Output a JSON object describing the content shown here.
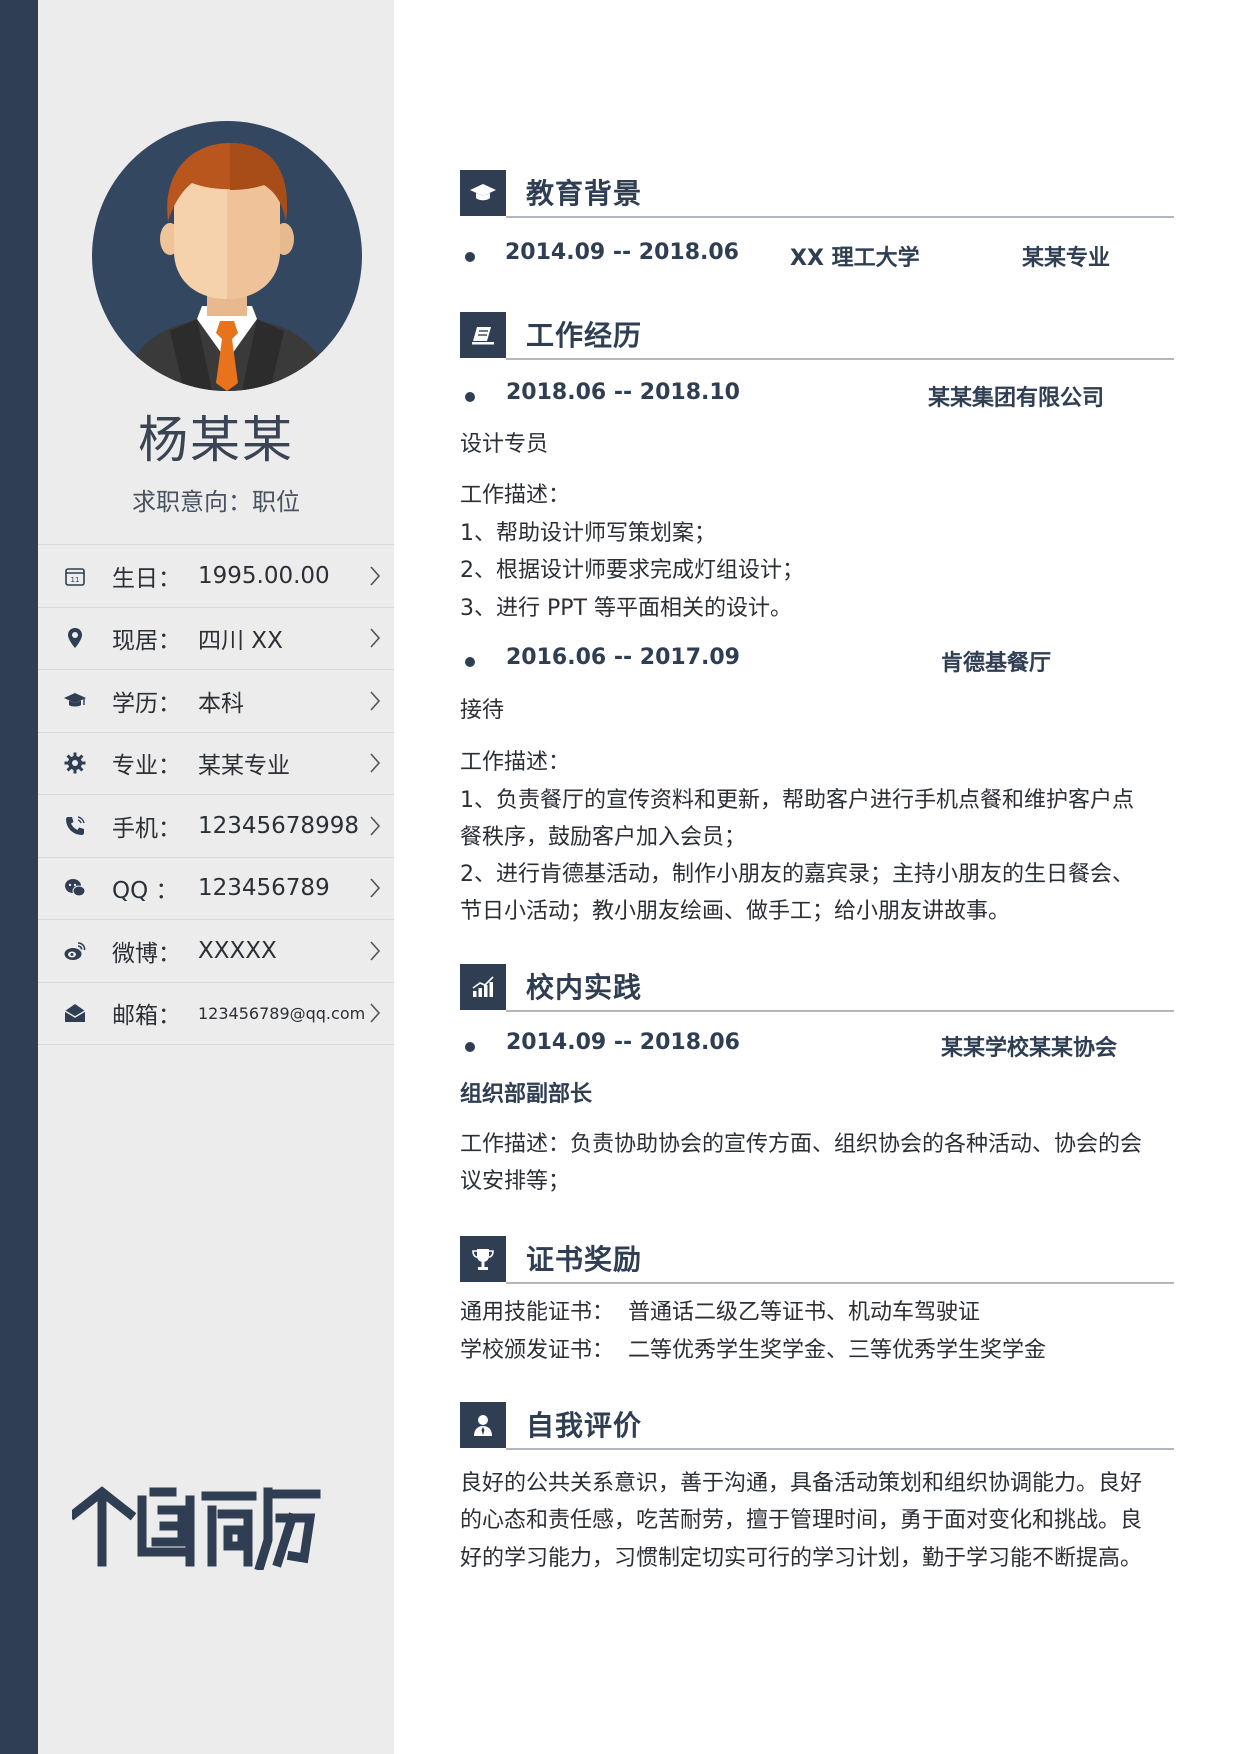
{
  "profile": {
    "name": "杨某某",
    "intent": "求职意向：职位"
  },
  "info": [
    {
      "icon": "calendar-icon",
      "label": "生日：",
      "value": "1995.00.00"
    },
    {
      "icon": "location-pin-icon",
      "label": "现居：",
      "value": "四川 XX"
    },
    {
      "icon": "graduation-cap-icon",
      "label": "学历：",
      "value": "本科"
    },
    {
      "icon": "gear-icon",
      "label": "专业：",
      "value": "某某专业"
    },
    {
      "icon": "phone-icon",
      "label": "手机：",
      "value": "12345678998"
    },
    {
      "icon": "chat-bubbles-icon",
      "label": "QQ ：",
      "value": "123456789"
    },
    {
      "icon": "weibo-icon",
      "label": "微博：",
      "value": "XXXXX"
    },
    {
      "icon": "envelope-icon",
      "label": "邮箱：",
      "value": "123456789@qq.com"
    }
  ],
  "logo_text": "个人简历",
  "sections": {
    "education": {
      "title": "教育背景",
      "icon": "graduation-cap-icon",
      "period": "2014.09 -- 2018.06",
      "school": "XX 理工大学",
      "major": "某某专业"
    },
    "work": {
      "title": "工作经历",
      "icon": "notebook-icon",
      "jobs": [
        {
          "period": "2018.06 -- 2018.10",
          "company": "某某集团有限公司",
          "role": "设计专员",
          "desc_label": "工作描述：",
          "lines": [
            "1、帮助设计师写策划案；",
            "2、根据设计师要求完成灯组设计；",
            "3、进行 PPT 等平面相关的设计。"
          ]
        },
        {
          "period": "2016.06 -- 2017.09",
          "company": "肯德基餐厅",
          "role": "接待",
          "desc_label": "工作描述：",
          "lines": [
            "1、负责餐厅的宣传资料和更新，帮助客户进行手机点餐和维护客户点",
            "餐秩序，鼓励客户加入会员；",
            "2、进行肯德基活动，制作小朋友的嘉宾录；主持小朋友的生日餐会、",
            "节日小活动；教小朋友绘画、做手工；给小朋友讲故事。"
          ]
        }
      ]
    },
    "campus": {
      "title": "校内实践",
      "icon": "bar-chart-icon",
      "period": "2014.09 -- 2018.06",
      "org": "某某学校某某协会",
      "role": "组织部副部长",
      "lines": [
        "工作描述：负责协助协会的宣传方面、组织协会的各种活动、协会的会",
        "议安排等；"
      ]
    },
    "awards": {
      "title": "证书奖励",
      "icon": "trophy-icon",
      "rows": [
        {
          "label": "通用技能证书：",
          "value": "普通话二级乙等证书、机动车驾驶证"
        },
        {
          "label": "学校颁发证书：",
          "value": "二等优秀学生奖学金、三等优秀学生奖学金"
        }
      ]
    },
    "self": {
      "title": "自我评价",
      "icon": "person-icon",
      "lines": [
        "良好的公共关系意识，善于沟通，具备活动策划和组织协调能力。良好",
        "的心态和责任感，吃苦耐劳，擅于管理时间，勇于面对变化和挑战。良",
        "好的学习能力，习惯制定切实可行的学习计划，勤于学习能不断提高。"
      ]
    }
  },
  "colors": {
    "navy": "#2f3e52",
    "sidebar": "#ececec",
    "avatar_bg": "#344761",
    "tie": "#e8731c",
    "hair": "#b8561e",
    "skin": "#f6d2ac"
  }
}
